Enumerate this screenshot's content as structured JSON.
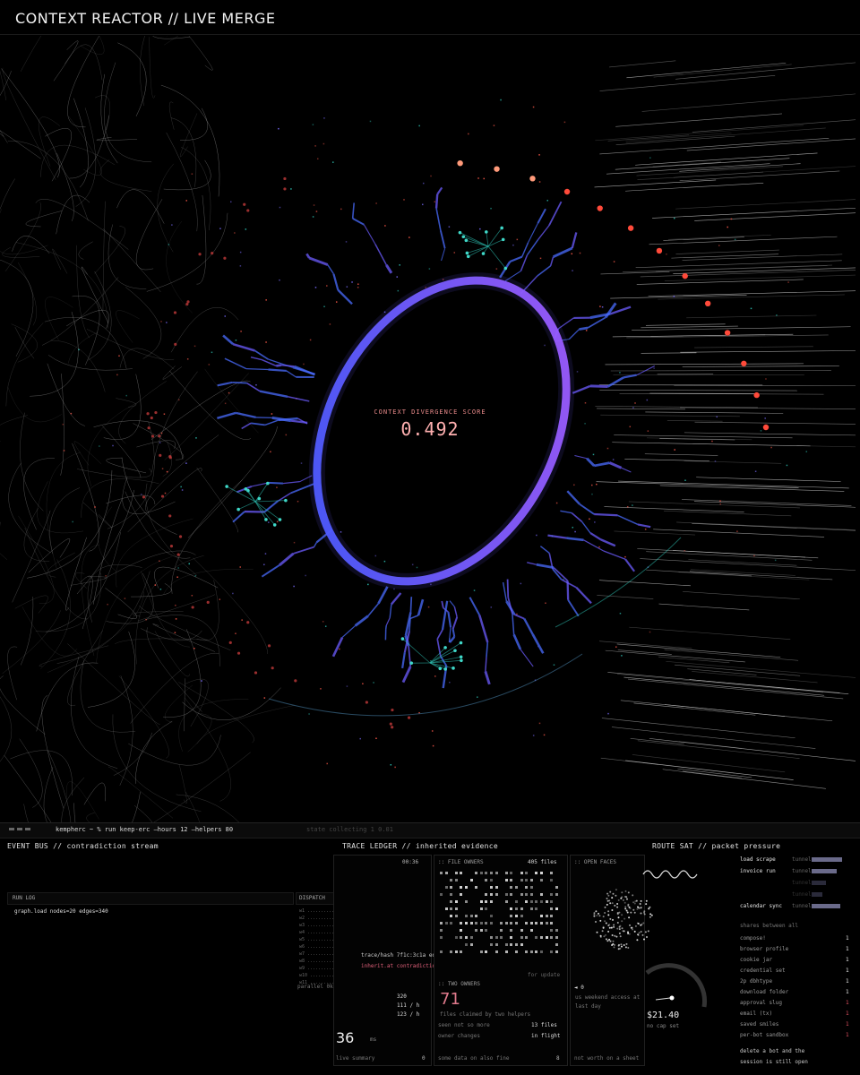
{
  "header": {
    "title": "CONTEXT REACTOR // LIVE MERGE"
  },
  "score": {
    "label": "CONTEXT DIVERGENCE SCORE",
    "value": "0.492"
  },
  "colors": {
    "ring_start": "#3b5bff",
    "ring_end": "#b05cff",
    "node_red": "#ff5a4a",
    "node_teal": "#2ec4b6",
    "score_text": "#ffb0b0"
  },
  "console": {
    "command": "kempherc  ~ % run keep-erc —hours 12 —helpers 80",
    "command_status": "state collecting     1 0.01",
    "event_bus": {
      "title": "EVENT BUS // contradiction stream",
      "runlog_label": "RUN LOG",
      "runlog_line": "graph.load  nodes=20 edges=340",
      "dispatch_label": "DISPATCH",
      "parallel_label": "parallel 0k"
    },
    "trace": {
      "title": "TRACE LEDGER // inherited evidence",
      "timer": "00:36",
      "trace_line": "trace/hash  7f1c:3c1a  edge=14  c284",
      "inherit_line": "inherit.at  contradictions=2  ctx/348",
      "counts": [
        "320",
        "111 / h",
        "123 / h"
      ],
      "big_number": "36",
      "big_suffix": "ms",
      "footer_left": "live summary",
      "footer_right": "0"
    },
    "file_owners": {
      "title": ":: FILE OWNERS",
      "count": "405 files",
      "footer_note": "for update",
      "two_owners_label": ":: TWO OWNERS",
      "two_owners_value": "71",
      "two_owners_desc": "files claimed by two helpers",
      "row1_left": "seen not so more",
      "row1_right": "13 files",
      "row2_left": "owner changes",
      "row2_right": "in flight",
      "footer_left": "some data on also fine",
      "footer_right": "8"
    },
    "open_faces": {
      "title": ":: OPEN FACES",
      "flag_label": "◄ 0",
      "line1": "us weekend access at",
      "line2": "last day",
      "cost": "$21.40",
      "cost_label": "no cap set",
      "footer": "not worth on a sheet"
    },
    "route": {
      "title": "ROUTE SAT // packet pressure",
      "rows": [
        {
          "label": "load scrape",
          "tag": "tunnel",
          "level": 0.85,
          "dim": false
        },
        {
          "label": "invoice run",
          "tag": "tunnel",
          "level": 0.7,
          "dim": false
        },
        {
          "label": "",
          "tag": "tunnel",
          "level": 0.4,
          "dim": true
        },
        {
          "label": "",
          "tag": "tunnel",
          "level": 0.3,
          "dim": true
        },
        {
          "label": "calendar sync",
          "tag": "tunnel",
          "level": 0.8,
          "dim": false
        }
      ],
      "shares_title": "shares between all",
      "shares": [
        {
          "label": "compose!",
          "value": "1"
        },
        {
          "label": "browser profile",
          "value": "1"
        },
        {
          "label": "cookie jar",
          "value": "1"
        },
        {
          "label": "credential set",
          "value": "1"
        },
        {
          "label": "2p dbhtype",
          "value": "1"
        },
        {
          "label": "download folder",
          "value": "1"
        },
        {
          "label": "approval slug",
          "value": "1"
        },
        {
          "label": "email (tx)",
          "value": "1"
        },
        {
          "label": "saved smiles",
          "value": "1"
        },
        {
          "label": "per-bot sandbox",
          "value": "1"
        }
      ],
      "footer_line1": "delete a bot and the",
      "footer_line2": "session is still open"
    }
  }
}
